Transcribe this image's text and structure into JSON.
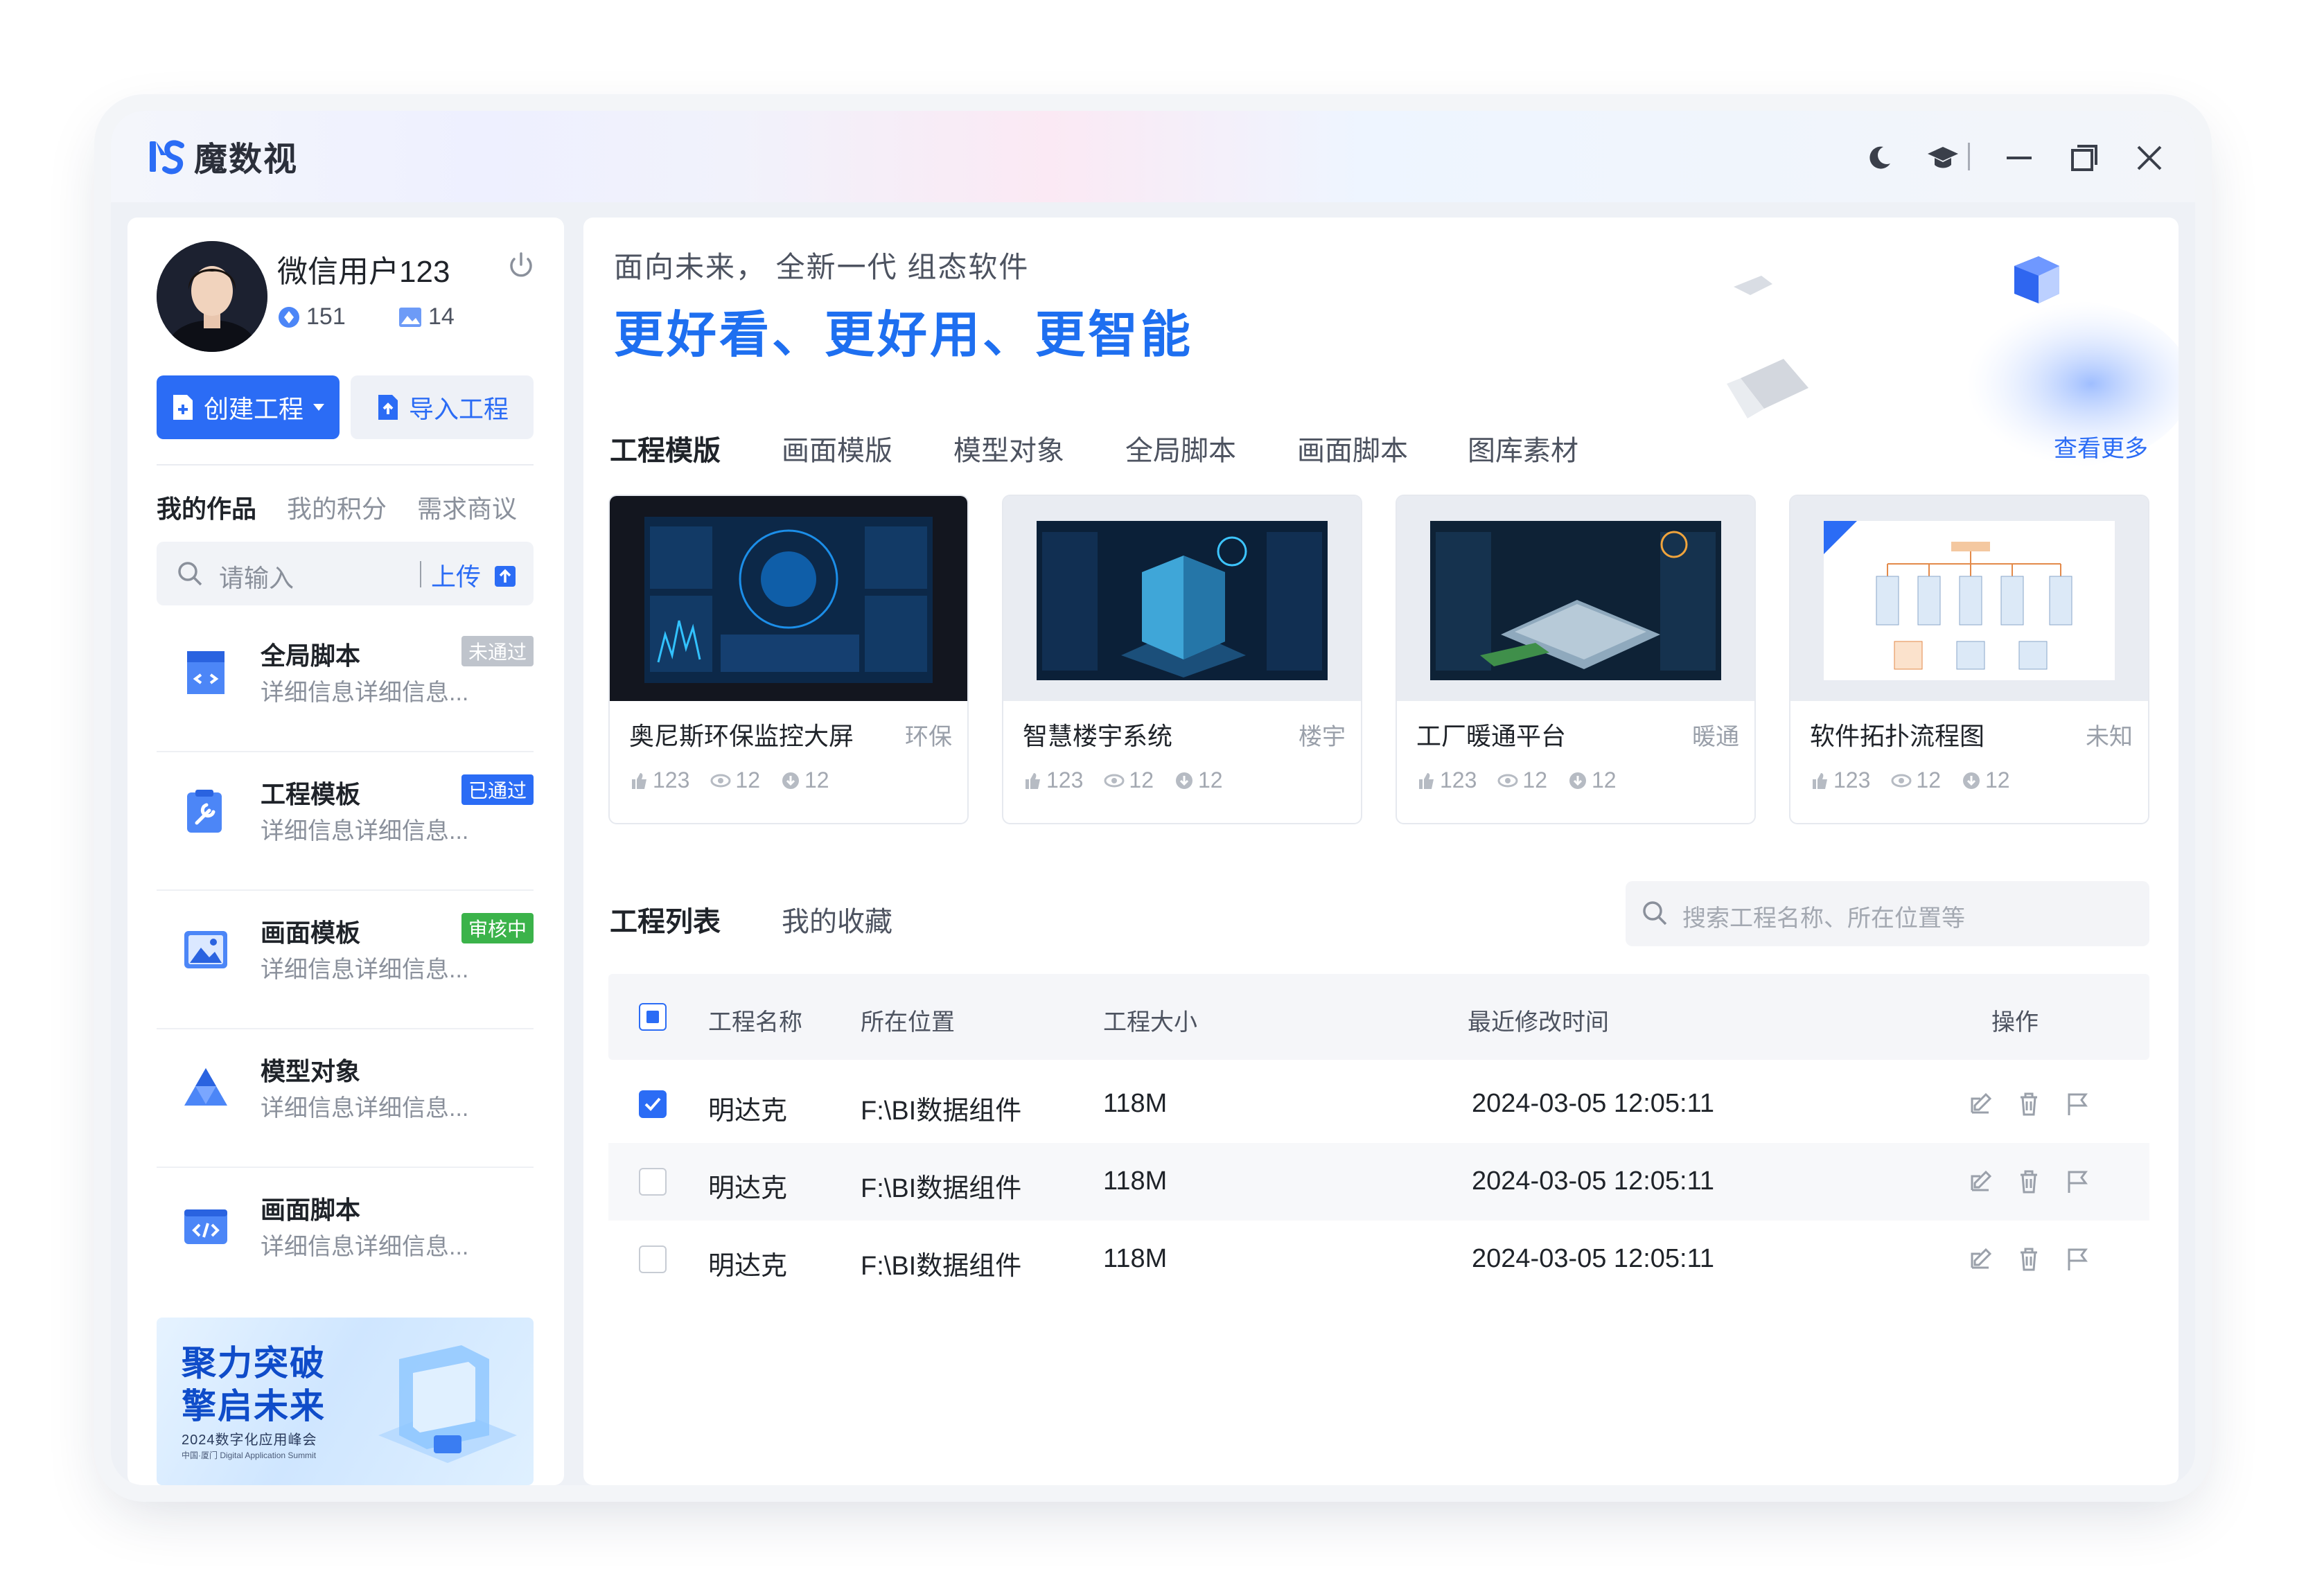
{
  "app": {
    "title": "魔数视"
  },
  "colors": {
    "accent": "#2b6cf5",
    "brand": "#1e6ff0",
    "success": "#3bb34a",
    "warning": "#bfc4cc"
  },
  "user": {
    "name": "微信用户123",
    "points": "151",
    "works": "14"
  },
  "actions": {
    "create": "创建工程",
    "import": "导入工程"
  },
  "left_tabs": [
    "我的作品",
    "我的积分",
    "需求商议"
  ],
  "left_search": {
    "placeholder": "请输入",
    "upload": "上传"
  },
  "works": [
    {
      "title": "全局脚本",
      "desc": "详细信息详细信息...",
      "badge": "未通过",
      "icon": "script-file-icon"
    },
    {
      "title": "工程模板",
      "desc": "详细信息详细信息...",
      "badge": "已通过",
      "icon": "wrench-doc-icon"
    },
    {
      "title": "画面模板",
      "desc": "详细信息详细信息...",
      "badge": "审核中",
      "icon": "image-icon"
    },
    {
      "title": "模型对象",
      "desc": "详细信息详细信息...",
      "badge": "",
      "icon": "model-triangle-icon"
    },
    {
      "title": "画面脚本",
      "desc": "详细信息详细信息...",
      "badge": "",
      "icon": "code-icon"
    }
  ],
  "banner": {
    "line1": "聚力突破",
    "line2": "擎启未来",
    "line3": "2024数字化应用峰会",
    "line4": "中国·厦门 Digital Application Summit"
  },
  "hero": {
    "subtitle": "面向未来， 全新一代 组态软件",
    "title": "更好看、更好用、更智能"
  },
  "template_tabs": [
    "工程模版",
    "画面模版",
    "模型对象",
    "全局脚本",
    "画面脚本",
    "图库素材"
  ],
  "more_label": "查看更多",
  "cards": [
    {
      "name": "奥尼斯环保监控大屏",
      "tag": "环保",
      "likes": "123",
      "views": "12",
      "downloads": "12"
    },
    {
      "name": "智慧楼宇系统",
      "tag": "楼宇",
      "likes": "123",
      "views": "12",
      "downloads": "12"
    },
    {
      "name": "工厂暖通平台",
      "tag": "暖通",
      "likes": "123",
      "views": "12",
      "downloads": "12"
    },
    {
      "name": "软件拓扑流程图",
      "tag": "未知",
      "likes": "123",
      "views": "12",
      "downloads": "12"
    }
  ],
  "project_tabs": [
    "工程列表",
    "我的收藏"
  ],
  "project_search": {
    "placeholder": "搜索工程名称、所在位置等"
  },
  "table": {
    "headers": [
      "工程名称",
      "所在位置",
      "工程大小",
      "最近修改时间",
      "操作"
    ],
    "rows": [
      {
        "checked": true,
        "name": "明达克",
        "location": "F:\\BI数据组件",
        "size": "118M",
        "modified": "2024-03-05 12:05:11"
      },
      {
        "checked": false,
        "name": "明达克",
        "location": "F:\\BI数据组件",
        "size": "118M",
        "modified": "2024-03-05 12:05:11"
      },
      {
        "checked": false,
        "name": "明达克",
        "location": "F:\\BI数据组件",
        "size": "118M",
        "modified": "2024-03-05 12:05:11"
      }
    ]
  }
}
